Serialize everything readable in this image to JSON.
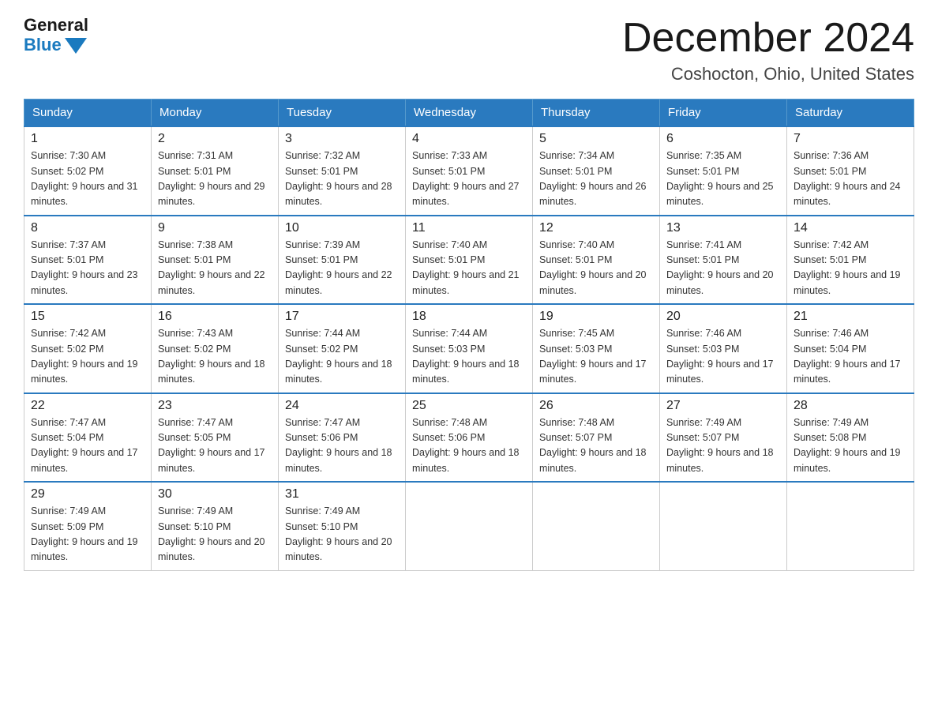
{
  "logo": {
    "general": "General",
    "blue": "Blue"
  },
  "header": {
    "month_title": "December 2024",
    "location": "Coshocton, Ohio, United States"
  },
  "days_of_week": [
    "Sunday",
    "Monday",
    "Tuesday",
    "Wednesday",
    "Thursday",
    "Friday",
    "Saturday"
  ],
  "weeks": [
    [
      {
        "day": "1",
        "sunrise": "7:30 AM",
        "sunset": "5:02 PM",
        "daylight": "9 hours and 31 minutes."
      },
      {
        "day": "2",
        "sunrise": "7:31 AM",
        "sunset": "5:01 PM",
        "daylight": "9 hours and 29 minutes."
      },
      {
        "day": "3",
        "sunrise": "7:32 AM",
        "sunset": "5:01 PM",
        "daylight": "9 hours and 28 minutes."
      },
      {
        "day": "4",
        "sunrise": "7:33 AM",
        "sunset": "5:01 PM",
        "daylight": "9 hours and 27 minutes."
      },
      {
        "day": "5",
        "sunrise": "7:34 AM",
        "sunset": "5:01 PM",
        "daylight": "9 hours and 26 minutes."
      },
      {
        "day": "6",
        "sunrise": "7:35 AM",
        "sunset": "5:01 PM",
        "daylight": "9 hours and 25 minutes."
      },
      {
        "day": "7",
        "sunrise": "7:36 AM",
        "sunset": "5:01 PM",
        "daylight": "9 hours and 24 minutes."
      }
    ],
    [
      {
        "day": "8",
        "sunrise": "7:37 AM",
        "sunset": "5:01 PM",
        "daylight": "9 hours and 23 minutes."
      },
      {
        "day": "9",
        "sunrise": "7:38 AM",
        "sunset": "5:01 PM",
        "daylight": "9 hours and 22 minutes."
      },
      {
        "day": "10",
        "sunrise": "7:39 AM",
        "sunset": "5:01 PM",
        "daylight": "9 hours and 22 minutes."
      },
      {
        "day": "11",
        "sunrise": "7:40 AM",
        "sunset": "5:01 PM",
        "daylight": "9 hours and 21 minutes."
      },
      {
        "day": "12",
        "sunrise": "7:40 AM",
        "sunset": "5:01 PM",
        "daylight": "9 hours and 20 minutes."
      },
      {
        "day": "13",
        "sunrise": "7:41 AM",
        "sunset": "5:01 PM",
        "daylight": "9 hours and 20 minutes."
      },
      {
        "day": "14",
        "sunrise": "7:42 AM",
        "sunset": "5:01 PM",
        "daylight": "9 hours and 19 minutes."
      }
    ],
    [
      {
        "day": "15",
        "sunrise": "7:42 AM",
        "sunset": "5:02 PM",
        "daylight": "9 hours and 19 minutes."
      },
      {
        "day": "16",
        "sunrise": "7:43 AM",
        "sunset": "5:02 PM",
        "daylight": "9 hours and 18 minutes."
      },
      {
        "day": "17",
        "sunrise": "7:44 AM",
        "sunset": "5:02 PM",
        "daylight": "9 hours and 18 minutes."
      },
      {
        "day": "18",
        "sunrise": "7:44 AM",
        "sunset": "5:03 PM",
        "daylight": "9 hours and 18 minutes."
      },
      {
        "day": "19",
        "sunrise": "7:45 AM",
        "sunset": "5:03 PM",
        "daylight": "9 hours and 17 minutes."
      },
      {
        "day": "20",
        "sunrise": "7:46 AM",
        "sunset": "5:03 PM",
        "daylight": "9 hours and 17 minutes."
      },
      {
        "day": "21",
        "sunrise": "7:46 AM",
        "sunset": "5:04 PM",
        "daylight": "9 hours and 17 minutes."
      }
    ],
    [
      {
        "day": "22",
        "sunrise": "7:47 AM",
        "sunset": "5:04 PM",
        "daylight": "9 hours and 17 minutes."
      },
      {
        "day": "23",
        "sunrise": "7:47 AM",
        "sunset": "5:05 PM",
        "daylight": "9 hours and 17 minutes."
      },
      {
        "day": "24",
        "sunrise": "7:47 AM",
        "sunset": "5:06 PM",
        "daylight": "9 hours and 18 minutes."
      },
      {
        "day": "25",
        "sunrise": "7:48 AM",
        "sunset": "5:06 PM",
        "daylight": "9 hours and 18 minutes."
      },
      {
        "day": "26",
        "sunrise": "7:48 AM",
        "sunset": "5:07 PM",
        "daylight": "9 hours and 18 minutes."
      },
      {
        "day": "27",
        "sunrise": "7:49 AM",
        "sunset": "5:07 PM",
        "daylight": "9 hours and 18 minutes."
      },
      {
        "day": "28",
        "sunrise": "7:49 AM",
        "sunset": "5:08 PM",
        "daylight": "9 hours and 19 minutes."
      }
    ],
    [
      {
        "day": "29",
        "sunrise": "7:49 AM",
        "sunset": "5:09 PM",
        "daylight": "9 hours and 19 minutes."
      },
      {
        "day": "30",
        "sunrise": "7:49 AM",
        "sunset": "5:10 PM",
        "daylight": "9 hours and 20 minutes."
      },
      {
        "day": "31",
        "sunrise": "7:49 AM",
        "sunset": "5:10 PM",
        "daylight": "9 hours and 20 minutes."
      },
      null,
      null,
      null,
      null
    ]
  ]
}
